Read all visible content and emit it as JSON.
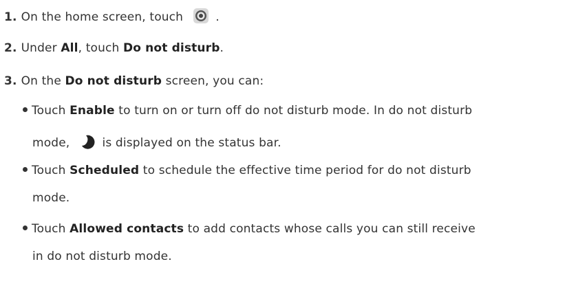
{
  "steps": [
    {
      "num": "1.",
      "text_a": "On the home screen, touch",
      "text_b": " ."
    },
    {
      "num": "2.",
      "text_a": "Under ",
      "bold_a": "All",
      "text_b": ", touch ",
      "bold_b": "Do not disturb",
      "text_c": "."
    },
    {
      "num": "3.",
      "text_a": "On the ",
      "bold_a": "Do not disturb",
      "text_b": " screen, you can:"
    }
  ],
  "bullets": [
    {
      "pre": "Touch ",
      "bold": "Enable",
      "post": " to turn on or turn off do not disturb mode. In do not disturb",
      "cont_pre": "mode,",
      "cont_post": " is displayed on the status bar."
    },
    {
      "pre": "Touch ",
      "bold": "Scheduled",
      "post": " to schedule the effective time period for do not disturb",
      "cont": "mode."
    },
    {
      "pre": "Touch ",
      "bold": "Allowed contacts",
      "post": " to add contacts whose calls you can still receive",
      "cont": "in do not disturb mode."
    }
  ],
  "icons": {
    "settings": "settings-gear-icon",
    "moon": "moon-icon"
  }
}
